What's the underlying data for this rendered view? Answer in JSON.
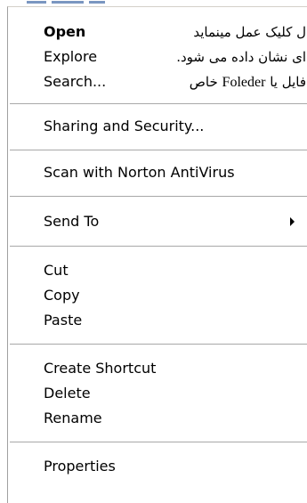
{
  "menu": {
    "open": "Open",
    "explore": "Explore",
    "search": "Search...",
    "sharing_security": "Sharing and Security...",
    "scan_norton": "Scan with Norton AntiVirus",
    "send_to": "Send To",
    "cut": "Cut",
    "copy": "Copy",
    "paste": "Paste",
    "create_shortcut": "Create Shortcut",
    "delete": "Delete",
    "rename": "Rename",
    "properties": "Properties"
  },
  "annotation": {
    "line1": "ل کلیک عمل مینماید",
    "line2": "ای نشان داده می شود.",
    "line3_prefix": "فایل یا",
    "line3_latin": "Foleder",
    "line3_suffix": "خاص"
  }
}
